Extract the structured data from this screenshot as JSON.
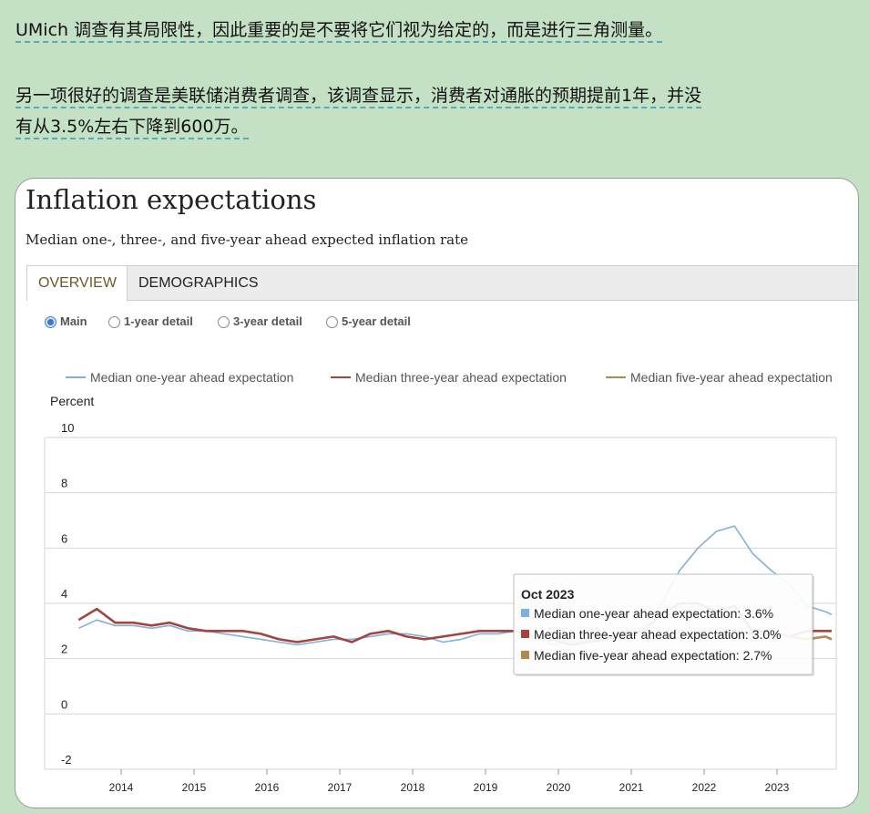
{
  "paragraphs": {
    "p1_line1": "UMich 调查有其局限性，因此重要的是不要将它们视为给定的，而是进行三角测量。",
    "p2_line1": "另一项很好的调查是美联储消费者调查，该调查显示，消费者对通胀的预期提前1年，并没",
    "p2_line2": "有从3.5%左右下降到600万。"
  },
  "card": {
    "title": "Inflation expectations",
    "subtitle": "Median one-, three-, and five-year ahead expected inflation rate"
  },
  "tabs": [
    {
      "label": "OVERVIEW",
      "active": true
    },
    {
      "label": "DEMOGRAPHICS",
      "active": false
    }
  ],
  "radios": [
    {
      "label": "Main",
      "checked": true
    },
    {
      "label": "1-year detail",
      "checked": false
    },
    {
      "label": "3-year detail",
      "checked": false
    },
    {
      "label": "5-year detail",
      "checked": false
    }
  ],
  "colors": {
    "one_year": "#7fb1e0",
    "three_year": "#a3453e",
    "five_year": "#b08a4e",
    "grid": "#d6d6d6",
    "background": "#c5e1c5"
  },
  "tooltip": {
    "title": "Oct 2023",
    "lines": [
      "Median one-year ahead expectation: 3.6%",
      "Median three-year ahead expectation: 3.0%",
      "Median five-year ahead expectation: 2.7%"
    ]
  },
  "chart_data": {
    "type": "line",
    "ylabel": "Percent",
    "ylim": [
      -2,
      10
    ],
    "yticks": [
      10,
      8,
      6,
      4,
      2,
      0,
      -2
    ],
    "xticks": [
      "2014",
      "2015",
      "2016",
      "2017",
      "2018",
      "2019",
      "2020",
      "2021",
      "2022",
      "2023"
    ],
    "legend_position": "top",
    "grid": true,
    "series": [
      {
        "name": "Median one-year ahead expectation",
        "x": [
          "2013-06",
          "2013-09",
          "2013-12",
          "2014-03",
          "2014-06",
          "2014-09",
          "2014-12",
          "2015-03",
          "2015-06",
          "2015-09",
          "2015-12",
          "2016-03",
          "2016-06",
          "2016-09",
          "2016-12",
          "2017-03",
          "2017-06",
          "2017-09",
          "2017-12",
          "2018-03",
          "2018-06",
          "2018-09",
          "2018-12",
          "2019-03",
          "2019-06",
          "2019-09",
          "2019-12",
          "2020-03",
          "2020-06",
          "2020-09",
          "2020-12",
          "2021-03",
          "2021-06",
          "2021-09",
          "2021-12",
          "2022-03",
          "2022-06",
          "2022-09",
          "2022-12",
          "2023-03",
          "2023-06",
          "2023-09",
          "2023-10"
        ],
        "values": [
          3.1,
          3.4,
          3.2,
          3.2,
          3.1,
          3.2,
          3.0,
          3.0,
          2.9,
          2.8,
          2.7,
          2.6,
          2.5,
          2.6,
          2.7,
          2.7,
          2.8,
          2.9,
          2.9,
          2.8,
          2.6,
          2.7,
          2.9,
          2.9,
          3.0,
          2.8,
          2.5,
          2.6,
          2.7,
          2.8,
          3.0,
          3.1,
          4.0,
          5.2,
          6.0,
          6.6,
          6.8,
          5.8,
          5.2,
          4.7,
          3.9,
          3.7,
          3.6
        ]
      },
      {
        "name": "Median three-year ahead expectation",
        "x": [
          "2013-06",
          "2013-09",
          "2013-12",
          "2014-03",
          "2014-06",
          "2014-09",
          "2014-12",
          "2015-03",
          "2015-06",
          "2015-09",
          "2015-12",
          "2016-03",
          "2016-06",
          "2016-09",
          "2016-12",
          "2017-03",
          "2017-06",
          "2017-09",
          "2017-12",
          "2018-03",
          "2018-06",
          "2018-09",
          "2018-12",
          "2019-03",
          "2019-06",
          "2019-09",
          "2019-12",
          "2020-03",
          "2020-06",
          "2020-09",
          "2020-12",
          "2021-03",
          "2021-06",
          "2021-09",
          "2021-12",
          "2022-03",
          "2022-06",
          "2022-09",
          "2022-12",
          "2023-03",
          "2023-06",
          "2023-09",
          "2023-10"
        ],
        "values": [
          3.4,
          3.8,
          3.3,
          3.3,
          3.2,
          3.3,
          3.1,
          3.0,
          3.0,
          3.0,
          2.9,
          2.7,
          2.6,
          2.7,
          2.8,
          2.6,
          2.9,
          3.0,
          2.8,
          2.7,
          2.8,
          2.9,
          3.0,
          3.0,
          3.0,
          2.8,
          2.7,
          2.5,
          2.6,
          2.7,
          2.9,
          3.0,
          3.6,
          4.0,
          4.0,
          3.7,
          3.9,
          3.0,
          3.0,
          2.8,
          3.0,
          3.0,
          3.0
        ]
      },
      {
        "name": "Median five-year ahead expectation",
        "x": [
          "2022-03",
          "2022-06",
          "2022-09",
          "2022-12",
          "2023-03",
          "2023-06",
          "2023-09",
          "2023-10"
        ],
        "values": [
          2.9,
          3.0,
          2.9,
          2.9,
          2.8,
          2.7,
          2.8,
          2.7
        ]
      }
    ]
  }
}
